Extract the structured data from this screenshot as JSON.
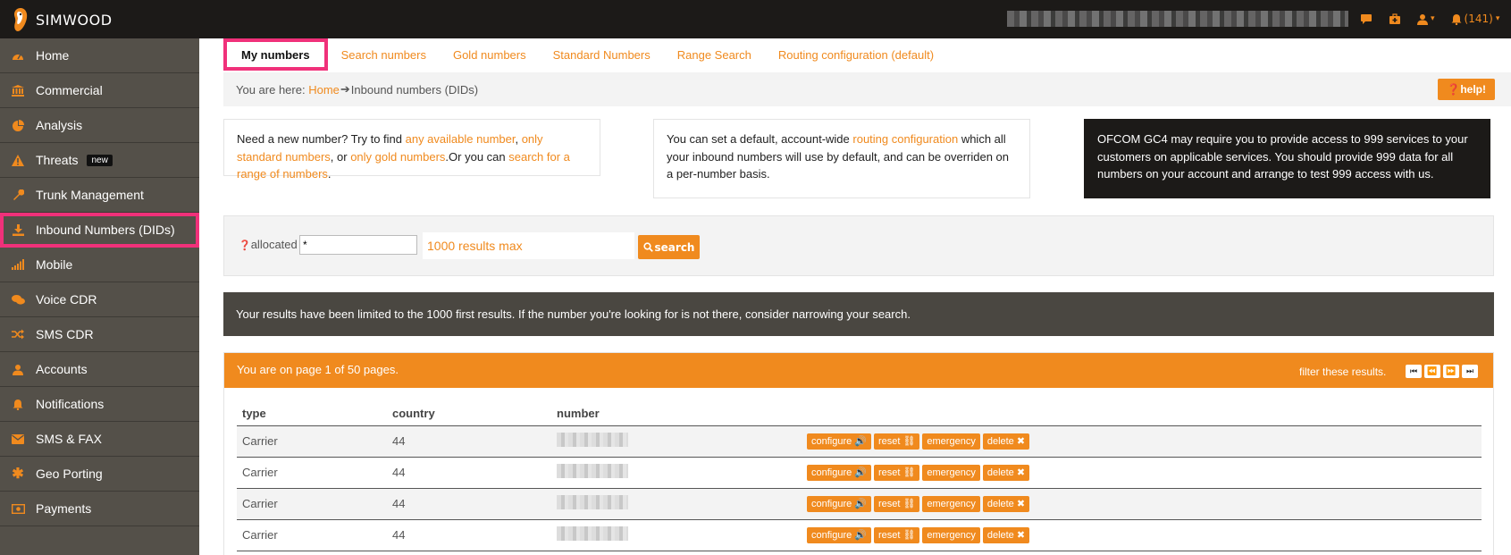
{
  "app": {
    "brand": "SIMWOOD",
    "notification_count": "(141)",
    "accent_color": "#f08a1e"
  },
  "sidebar": {
    "items": [
      {
        "label": "Home",
        "icon": "dashboard-icon"
      },
      {
        "label": "Commercial",
        "icon": "bank-icon"
      },
      {
        "label": "Analysis",
        "icon": "pie-chart-icon"
      },
      {
        "label": "Threats",
        "icon": "warning-icon",
        "badge": "new"
      },
      {
        "label": "Trunk Management",
        "icon": "wrench-icon"
      },
      {
        "label": "Inbound Numbers (DIDs)",
        "icon": "download-icon"
      },
      {
        "label": "Mobile",
        "icon": "signal-icon"
      },
      {
        "label": "Voice CDR",
        "icon": "comments-icon"
      },
      {
        "label": "SMS CDR",
        "icon": "shuffle-icon"
      },
      {
        "label": "Accounts",
        "icon": "user-icon"
      },
      {
        "label": "Notifications",
        "icon": "bell-icon"
      },
      {
        "label": "SMS & FAX",
        "icon": "envelope-icon"
      },
      {
        "label": "Geo Porting",
        "icon": "asterisk-icon"
      },
      {
        "label": "Payments",
        "icon": "money-icon"
      }
    ]
  },
  "tabs": [
    {
      "label": "My numbers",
      "active": true
    },
    {
      "label": "Search numbers"
    },
    {
      "label": "Gold numbers"
    },
    {
      "label": "Standard Numbers"
    },
    {
      "label": "Range Search"
    },
    {
      "label": "Routing configuration (default)"
    }
  ],
  "breadcrumb": {
    "prefix": "You are here: ",
    "home": "Home",
    "current": "Inbound numbers (DIDs)",
    "help": "help!"
  },
  "info1": {
    "t1": "Need a new number? Try to find ",
    "l1": "any available number",
    "t2": ", ",
    "l2": "only standard numbers",
    "t3": ", or ",
    "l3": "only gold numbers",
    "t4": ".Or you can ",
    "l4": "search for a range of numbers",
    "t5": "."
  },
  "info2": {
    "t1": "You can set a default, account-wide ",
    "l1": "routing configuration",
    "t2": " which all your inbound numbers will use by default, and can be overriden on a per-number basis."
  },
  "info3": {
    "text": "OFCOM GC4 may require you to provide access to 999 services to your customers on applicable services. You should provide 999 data for all numbers on your account and arrange to test 999 access with us."
  },
  "search": {
    "label": "allocated",
    "value": "*",
    "limit": "1000 results max",
    "button": "search"
  },
  "notice": "Your results have been limited to the 1000 first results. If the number you're looking for is not there, consider narrowing your search.",
  "results": {
    "page_info": "You are on page 1 of 50 pages.",
    "filter": "filter these results.",
    "columns": [
      "type",
      "country",
      "number"
    ],
    "rows": [
      {
        "type": "Carrier",
        "country": "44"
      },
      {
        "type": "Carrier",
        "country": "44"
      },
      {
        "type": "Carrier",
        "country": "44"
      },
      {
        "type": "Carrier",
        "country": "44"
      }
    ],
    "actions": {
      "configure": "configure",
      "reset": "reset",
      "emergency": "emergency",
      "delete": "delete"
    }
  }
}
